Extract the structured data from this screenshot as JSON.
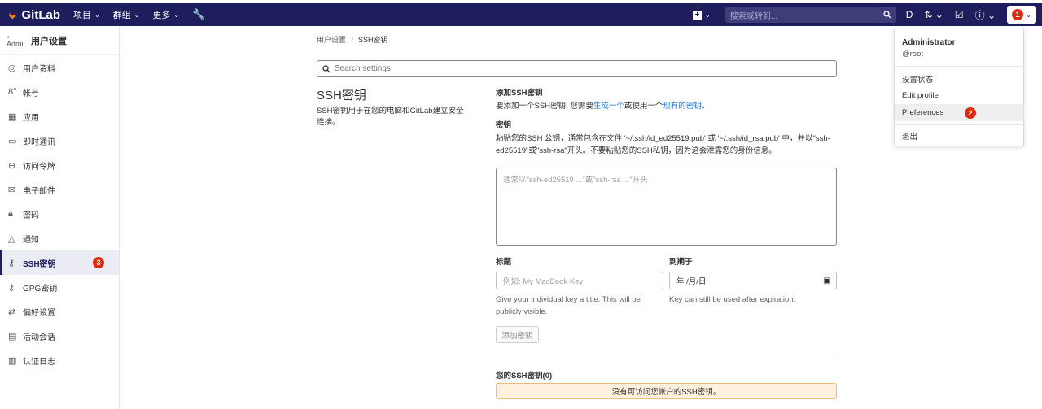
{
  "topbar": {
    "brand": "GitLab",
    "nav": [
      "项目",
      "群组",
      "更多"
    ],
    "search_placeholder": "搜索或转到...",
    "avatar_badge": "1"
  },
  "sidebar": {
    "avatar_alt": "Admi",
    "title": "用户设置",
    "items": [
      {
        "label": "用户资料",
        "icon": "profile-icon"
      },
      {
        "label": "帐号",
        "icon": "account-icon"
      },
      {
        "label": "应用",
        "icon": "applications-icon"
      },
      {
        "label": "即时通讯",
        "icon": "chat-icon"
      },
      {
        "label": "访问令牌",
        "icon": "token-icon"
      },
      {
        "label": "电子邮件",
        "icon": "mail-icon"
      },
      {
        "label": "密码",
        "icon": "lock-icon"
      },
      {
        "label": "通知",
        "icon": "bell-icon"
      },
      {
        "label": "SSH密钥",
        "icon": "key-icon",
        "active": true,
        "badge": "3"
      },
      {
        "label": "GPG密钥",
        "icon": "key-icon"
      },
      {
        "label": "偏好设置",
        "icon": "preferences-icon"
      },
      {
        "label": "活动会话",
        "icon": "monitor-icon"
      },
      {
        "label": "认证日志",
        "icon": "log-icon"
      }
    ]
  },
  "breadcrumb": {
    "parent": "用户设置",
    "separator": "›",
    "current": "SSH密钥"
  },
  "search_settings": {
    "placeholder": "Search settings"
  },
  "section": {
    "title": "SSH密钥",
    "description": "SSH密钥用于在您的电脑和GitLab建立安全连接。"
  },
  "form": {
    "add_title": "添加SSH密钥",
    "intro_prefix": "要添加一个SSH密钥, 您需要",
    "intro_link1": "生成一个",
    "intro_mid": "或使用一个",
    "intro_link2": "现有的密钥",
    "intro_suffix": "。",
    "key_label": "密钥",
    "key_help": "粘贴您的SSH 公钥，通常包含在文件 '~/.ssh/id_ed25519.pub' 或 '~/.ssh/id_rsa.pub' 中，并以\"ssh-ed25519\"或\"ssh-rsa\"开头。不要粘贴您的SSH私钥，因为这会泄露您的身份信息。",
    "key_placeholder": "通常以\"ssh-ed25519 ...\"或\"ssh-rsa ...\"开头",
    "title_label": "标题",
    "title_placeholder": "例如: My MacBook Key",
    "title_help": "Give your individual key a title. This will be publicly visible.",
    "expires_label": "到期于",
    "expires_value": "年 /月/日",
    "expires_help": "Key can still be used after expiration.",
    "add_button": "添加密钥",
    "your_keys": "您的SSH密钥(0)",
    "empty_notice": "没有可访问您帐户的SSH密钥。"
  },
  "dropdown": {
    "name": "Administrator",
    "username": "@root",
    "items": [
      "设置状态",
      "Edit profile",
      "Preferences",
      "退出"
    ],
    "preferences_badge": "2"
  }
}
